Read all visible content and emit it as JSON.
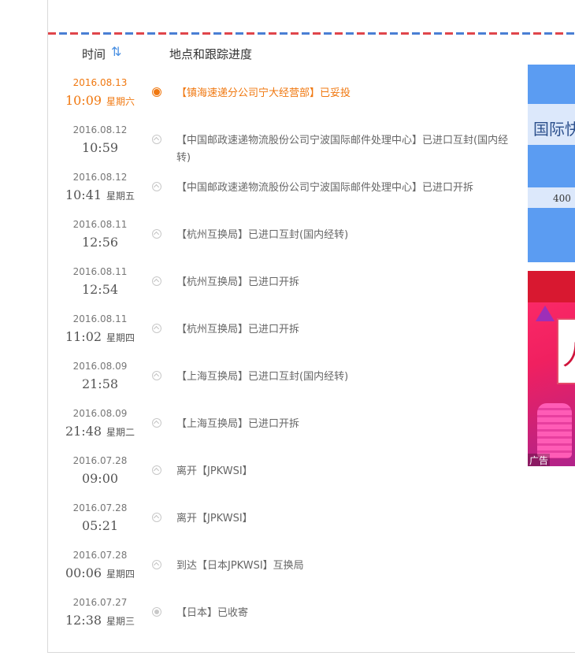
{
  "header": {
    "time_label": "时间",
    "sort_icon": "⇅",
    "place_label": "地点和跟踪进度"
  },
  "events": [
    {
      "date": "2016.08.13",
      "time": "10:09",
      "weekday": "星期六",
      "desc": "【镇海速递分公司宁大经营部】已妥投",
      "status": "current"
    },
    {
      "date": "2016.08.12",
      "time": "10:59",
      "weekday": "",
      "desc": "【中国邮政速递物流股份公司宁波国际邮件处理中心】已进口互封(国内经转)",
      "status": "past"
    },
    {
      "date": "2016.08.12",
      "time": "10:41",
      "weekday": "星期五",
      "desc": "【中国邮政速递物流股份公司宁波国际邮件处理中心】已进口开拆",
      "status": "past"
    },
    {
      "date": "2016.08.11",
      "time": "12:56",
      "weekday": "",
      "desc": "【杭州互换局】已进口互封(国内经转)",
      "status": "past"
    },
    {
      "date": "2016.08.11",
      "time": "12:54",
      "weekday": "",
      "desc": "【杭州互换局】已进口开拆",
      "status": "past"
    },
    {
      "date": "2016.08.11",
      "time": "11:02",
      "weekday": "星期四",
      "desc": "【杭州互换局】已进口开拆",
      "status": "past"
    },
    {
      "date": "2016.08.09",
      "time": "21:58",
      "weekday": "",
      "desc": "【上海互换局】已进口互封(国内经转)",
      "status": "past"
    },
    {
      "date": "2016.08.09",
      "time": "21:48",
      "weekday": "星期二",
      "desc": "【上海互换局】已进口开拆",
      "status": "past"
    },
    {
      "date": "2016.07.28",
      "time": "09:00",
      "weekday": "",
      "desc": "离开【JPKWSI】",
      "status": "past"
    },
    {
      "date": "2016.07.28",
      "time": "05:21",
      "weekday": "",
      "desc": "离开【JPKWSI】",
      "status": "past"
    },
    {
      "date": "2016.07.28",
      "time": "00:06",
      "weekday": "星期四",
      "desc": "到达【日本JPKWSI】互换局",
      "status": "past"
    },
    {
      "date": "2016.07.27",
      "time": "12:38",
      "weekday": "星期三",
      "desc": "【日本】已收寄",
      "status": "origin"
    }
  ],
  "ads": {
    "ad1_text": "国际快",
    "ad1_phone": "400",
    "ad2_glyph": "人",
    "ad2_label": "广告"
  },
  "colors": {
    "accent_orange": "#f07810",
    "airmail_red": "#e0454b",
    "airmail_blue": "#4a7fd4"
  }
}
